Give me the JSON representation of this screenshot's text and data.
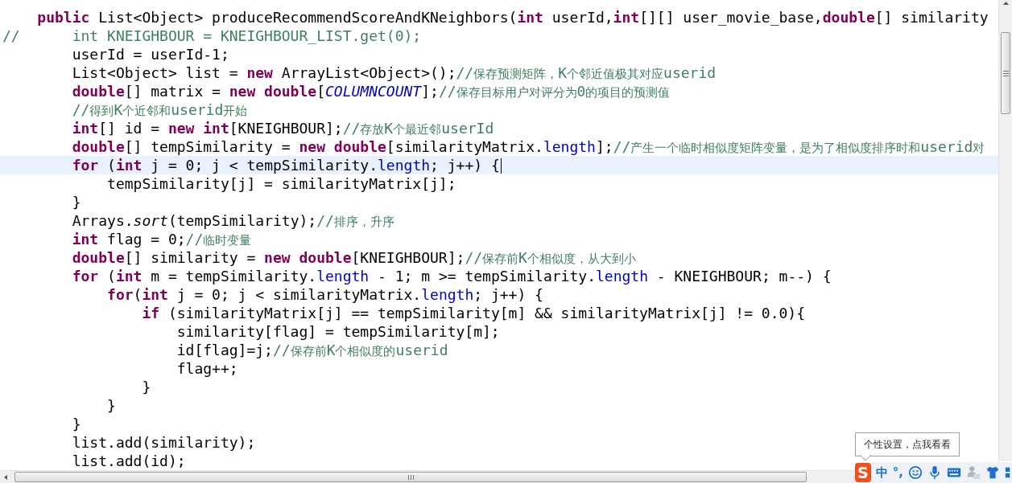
{
  "editor": {
    "lines": [
      {
        "current": false,
        "tokens": [
          {
            "text": "    public",
            "kind": "keyword"
          },
          {
            "text": " List<Object> produceRecommendScoreAndKNeighbors(",
            "kind": "plain"
          },
          {
            "text": "int",
            "kind": "keyword"
          },
          {
            "text": " userId,",
            "kind": "plain"
          },
          {
            "text": "int",
            "kind": "keyword"
          },
          {
            "text": "[][] user_movie_base,",
            "kind": "plain"
          },
          {
            "text": "double",
            "kind": "keyword"
          },
          {
            "text": "[] similarity",
            "kind": "plain"
          }
        ]
      },
      {
        "current": false,
        "tokens": [
          {
            "text": "//      int KNEIGHBOUR = KNEIGHBOUR_LIST.get(0);",
            "kind": "comment"
          }
        ]
      },
      {
        "current": false,
        "tokens": [
          {
            "text": "        userId = userId-1;",
            "kind": "plain"
          }
        ]
      },
      {
        "current": false,
        "tokens": [
          {
            "text": "        List<Object> list = ",
            "kind": "plain"
          },
          {
            "text": "new",
            "kind": "keyword"
          },
          {
            "text": " ArrayList<Object>();",
            "kind": "plain"
          },
          {
            "text": "//保存预测矩阵，K个邻近值极其对应userid",
            "kind": "comment"
          }
        ]
      },
      {
        "current": false,
        "tokens": [
          {
            "text": "        double",
            "kind": "keyword"
          },
          {
            "text": "[] matrix = ",
            "kind": "plain"
          },
          {
            "text": "new double",
            "kind": "keyword"
          },
          {
            "text": "[",
            "kind": "plain"
          },
          {
            "text": "COLUMNCOUNT",
            "kind": "constant"
          },
          {
            "text": "];",
            "kind": "plain"
          },
          {
            "text": "//保存目标用户对评分为0的项目的预测值",
            "kind": "comment"
          }
        ]
      },
      {
        "current": false,
        "tokens": [
          {
            "text": "        //得到K个近邻和userid开始",
            "kind": "comment"
          }
        ]
      },
      {
        "current": false,
        "tokens": [
          {
            "text": "        int",
            "kind": "keyword"
          },
          {
            "text": "[] id = ",
            "kind": "plain"
          },
          {
            "text": "new int",
            "kind": "keyword"
          },
          {
            "text": "[KNEIGHBOUR];",
            "kind": "plain"
          },
          {
            "text": "//存放K个最近邻userId",
            "kind": "comment"
          }
        ]
      },
      {
        "current": false,
        "tokens": [
          {
            "text": "        double",
            "kind": "keyword"
          },
          {
            "text": "[] tempSimilarity = ",
            "kind": "plain"
          },
          {
            "text": "new double",
            "kind": "keyword"
          },
          {
            "text": "[similarityMatrix.",
            "kind": "plain"
          },
          {
            "text": "length",
            "kind": "field"
          },
          {
            "text": "];",
            "kind": "plain"
          },
          {
            "text": "//产生一个临时相似度矩阵变量，是为了相似度排序时和userid对",
            "kind": "comment"
          }
        ]
      },
      {
        "current": true,
        "tokens": [
          {
            "text": "        for",
            "kind": "keyword"
          },
          {
            "text": " (",
            "kind": "plain"
          },
          {
            "text": "int",
            "kind": "keyword"
          },
          {
            "text": " j = 0; j < tempSimilarity.",
            "kind": "plain"
          },
          {
            "text": "length",
            "kind": "field"
          },
          {
            "text": "; j++) {",
            "kind": "plain"
          }
        ]
      },
      {
        "current": false,
        "tokens": [
          {
            "text": "            tempSimilarity[j] = similarityMatrix[j];",
            "kind": "plain"
          }
        ]
      },
      {
        "current": false,
        "tokens": [
          {
            "text": "        }",
            "kind": "plain"
          }
        ]
      },
      {
        "current": false,
        "tokens": [
          {
            "text": "        Arrays.",
            "kind": "plain"
          },
          {
            "text": "sort",
            "kind": "static"
          },
          {
            "text": "(tempSimilarity);",
            "kind": "plain"
          },
          {
            "text": "//排序，升序",
            "kind": "comment"
          }
        ]
      },
      {
        "current": false,
        "tokens": [
          {
            "text": "        int",
            "kind": "keyword"
          },
          {
            "text": " flag = 0;",
            "kind": "plain"
          },
          {
            "text": "//临时变量",
            "kind": "comment"
          }
        ]
      },
      {
        "current": false,
        "tokens": [
          {
            "text": "        double",
            "kind": "keyword"
          },
          {
            "text": "[] similarity = ",
            "kind": "plain"
          },
          {
            "text": "new double",
            "kind": "keyword"
          },
          {
            "text": "[KNEIGHBOUR];",
            "kind": "plain"
          },
          {
            "text": "//保存前K个相似度，从大到小",
            "kind": "comment"
          }
        ]
      },
      {
        "current": false,
        "tokens": [
          {
            "text": "        for",
            "kind": "keyword"
          },
          {
            "text": " (",
            "kind": "plain"
          },
          {
            "text": "int",
            "kind": "keyword"
          },
          {
            "text": " m = tempSimilarity.",
            "kind": "plain"
          },
          {
            "text": "length",
            "kind": "field"
          },
          {
            "text": " - 1; m >= tempSimilarity.",
            "kind": "plain"
          },
          {
            "text": "length",
            "kind": "field"
          },
          {
            "text": " - KNEIGHBOUR; m--) {",
            "kind": "plain"
          }
        ]
      },
      {
        "current": false,
        "tokens": [
          {
            "text": "            for",
            "kind": "keyword"
          },
          {
            "text": "(",
            "kind": "plain"
          },
          {
            "text": "int",
            "kind": "keyword"
          },
          {
            "text": " j = 0; j < similarityMatrix.",
            "kind": "plain"
          },
          {
            "text": "length",
            "kind": "field"
          },
          {
            "text": "; j++) {",
            "kind": "plain"
          }
        ]
      },
      {
        "current": false,
        "tokens": [
          {
            "text": "                if",
            "kind": "keyword"
          },
          {
            "text": " (similarityMatrix[j] == tempSimilarity[m] && similarityMatrix[j] != 0.0){",
            "kind": "plain"
          }
        ]
      },
      {
        "current": false,
        "tokens": [
          {
            "text": "                    similarity[flag] = tempSimilarity[m];",
            "kind": "plain"
          }
        ]
      },
      {
        "current": false,
        "tokens": [
          {
            "text": "                    id[flag]=j;",
            "kind": "plain"
          },
          {
            "text": "//保存前K个相似度的userid",
            "kind": "comment"
          }
        ]
      },
      {
        "current": false,
        "tokens": [
          {
            "text": "                    flag++;",
            "kind": "plain"
          }
        ]
      },
      {
        "current": false,
        "tokens": [
          {
            "text": "                }",
            "kind": "plain"
          }
        ]
      },
      {
        "current": false,
        "tokens": [
          {
            "text": "            }",
            "kind": "plain"
          }
        ]
      },
      {
        "current": false,
        "tokens": [
          {
            "text": "        }",
            "kind": "plain"
          }
        ]
      },
      {
        "current": false,
        "tokens": [
          {
            "text": "        list.add(similarity);",
            "kind": "plain"
          }
        ]
      },
      {
        "current": false,
        "tokens": [
          {
            "text": "        list.add(id);",
            "kind": "plain"
          }
        ]
      }
    ]
  },
  "ime_toolbar": {
    "tooltip": "个性设置，点我看看",
    "logo": "S",
    "items": [
      {
        "kind": "text",
        "text": "中"
      },
      {
        "kind": "text",
        "text": "°,"
      },
      {
        "kind": "smiley"
      },
      {
        "kind": "microphone"
      },
      {
        "kind": "keyboard"
      },
      {
        "kind": "user"
      },
      {
        "kind": "shirt"
      },
      {
        "kind": "grid"
      }
    ]
  }
}
